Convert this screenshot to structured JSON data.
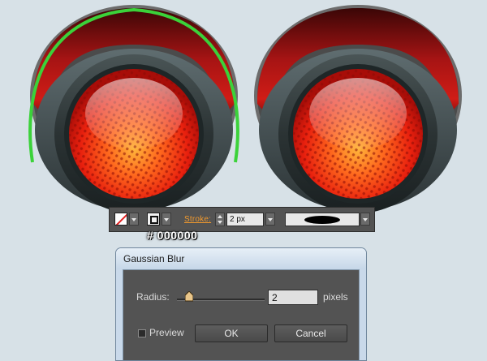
{
  "artwork": {
    "description_icons": [
      "traffic-light-left",
      "traffic-light-right"
    ],
    "selection_color": "#3bd23a"
  },
  "control_strip": {
    "fill_icon": "no-fill-swatch-icon",
    "stroke_icon": "stroke-swatch-icon",
    "stroke_label": "Stroke:",
    "stroke_weight": "2 px",
    "profile_icon": "width-profile-icon"
  },
  "color_annotation": "# 000000",
  "dialog": {
    "title": "Gaussian Blur",
    "radius_label": "Radius:",
    "radius_value": "2",
    "units": "pixels",
    "preview_label": "Preview",
    "preview_checked": false,
    "ok_label": "OK",
    "cancel_label": "Cancel"
  }
}
